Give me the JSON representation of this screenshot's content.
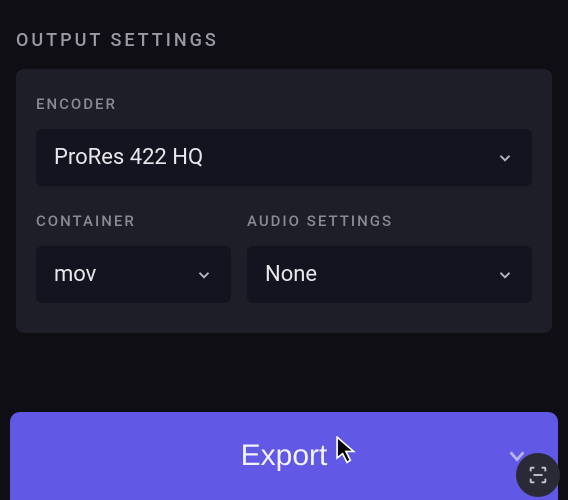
{
  "section_title": "OUTPUT SETTINGS",
  "encoder": {
    "label": "ENCODER",
    "value": "ProRes 422 HQ"
  },
  "container": {
    "label": "CONTAINER",
    "value": "mov"
  },
  "audio": {
    "label": "AUDIO SETTINGS",
    "value": "None"
  },
  "export_label": "Export"
}
